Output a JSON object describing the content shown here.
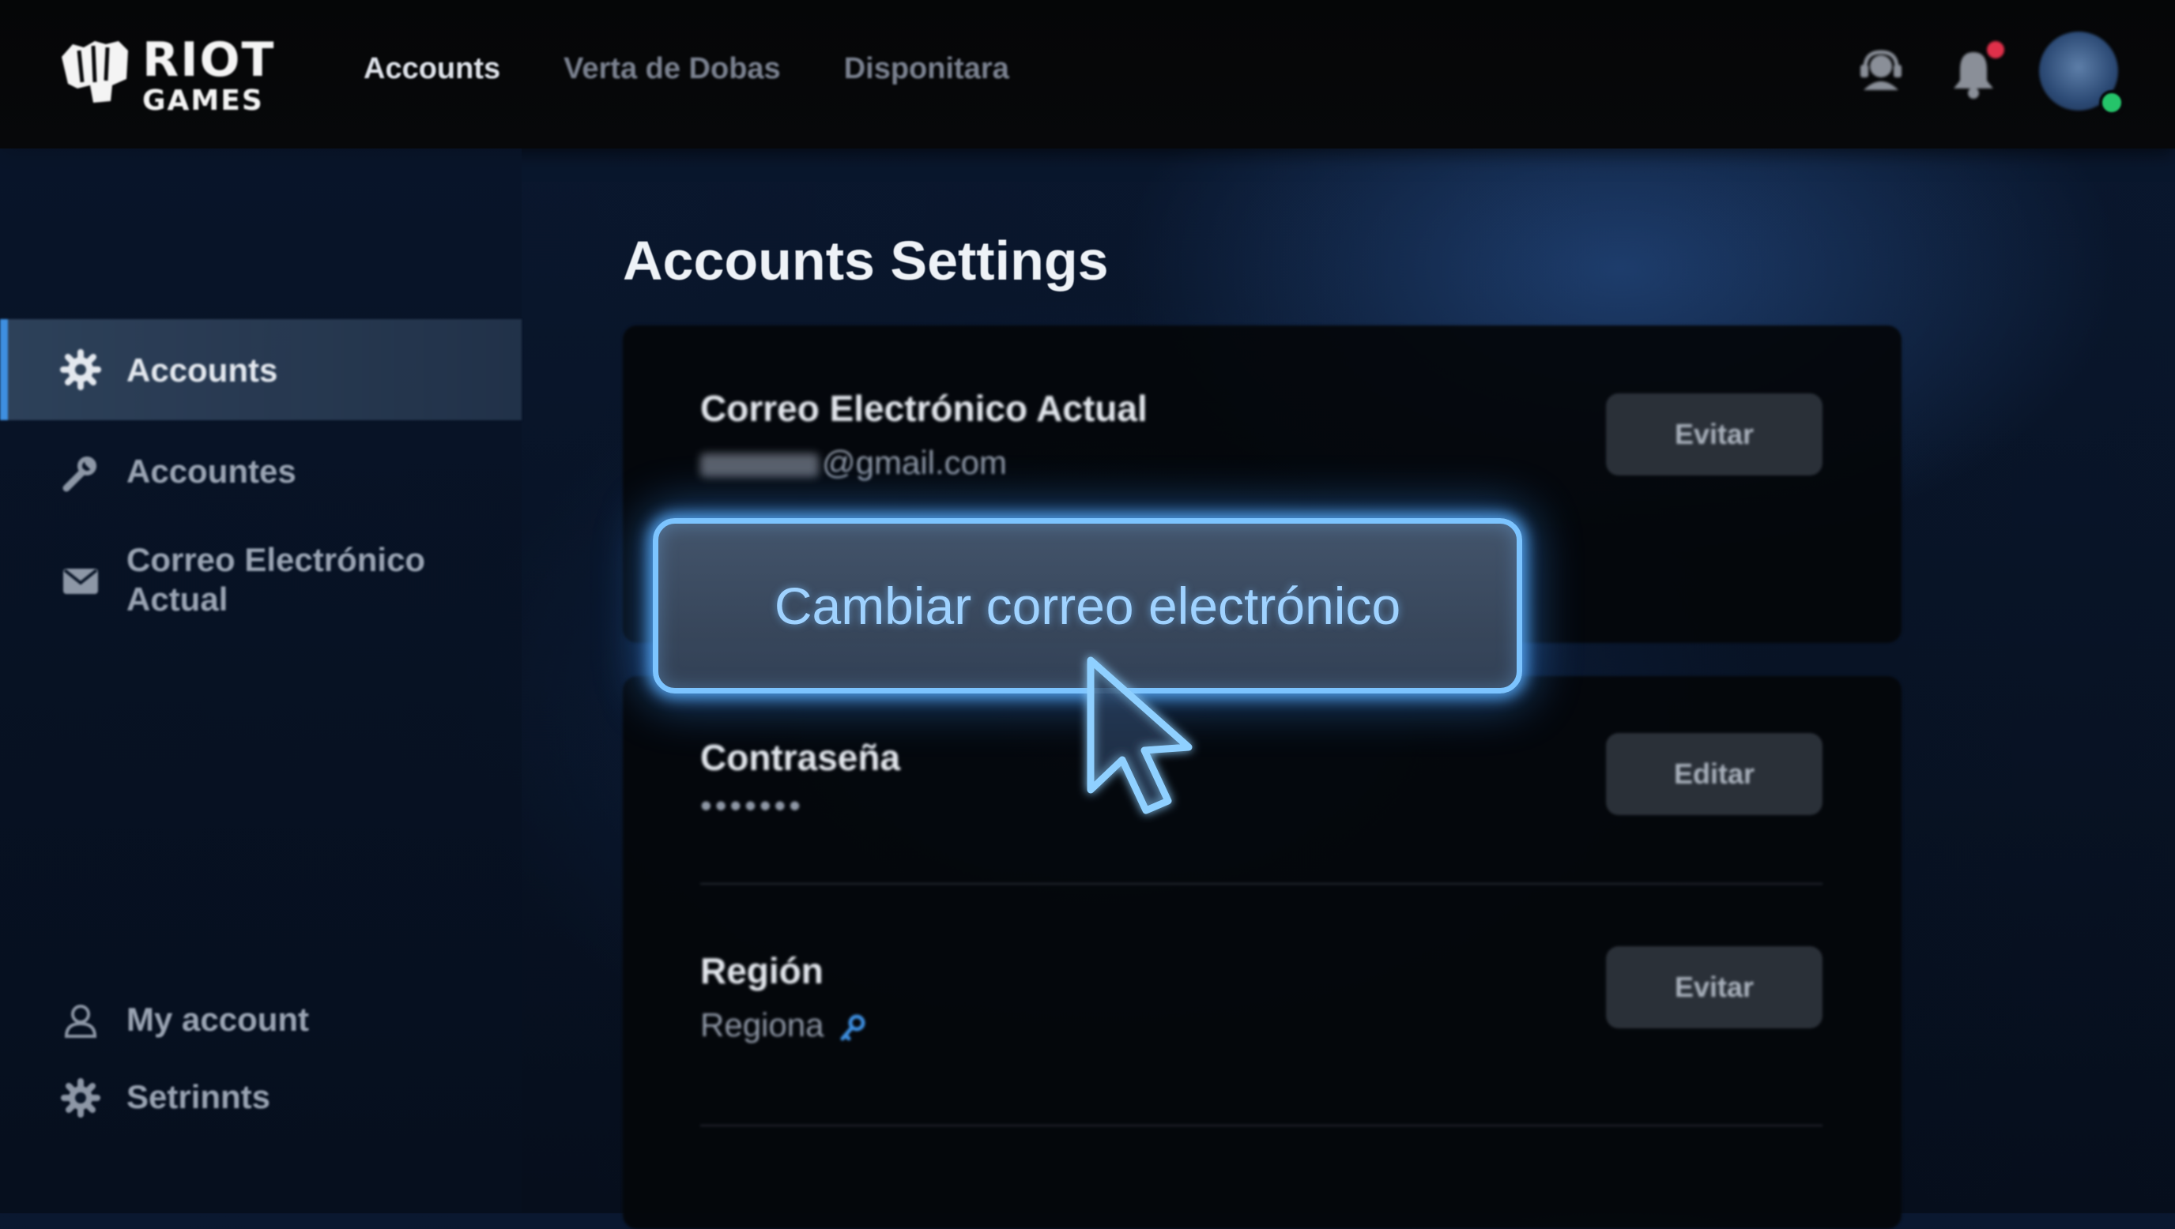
{
  "brand": {
    "name_line1": "RIOT",
    "name_line2": "GAMES"
  },
  "topnav": {
    "items": [
      {
        "label": "Accounts",
        "active": true
      },
      {
        "label": "Verta de Dobas",
        "active": false
      },
      {
        "label": "Disponitara",
        "active": false
      }
    ],
    "icons": [
      "support-icon",
      "bell-icon",
      "avatar"
    ]
  },
  "sidebar": {
    "items": [
      {
        "label": "Accounts",
        "icon": "gear-icon",
        "active": true
      },
      {
        "label": "Accountes",
        "icon": "wrench-icon",
        "active": false
      },
      {
        "label": "Correo Electrónico Actual",
        "icon": "mail-icon",
        "active": false
      }
    ],
    "bottom": [
      {
        "label": "My account",
        "icon": "user-icon"
      },
      {
        "label": "Setrinnts",
        "icon": "gear-icon"
      }
    ]
  },
  "main": {
    "title": "Accounts Settings",
    "email_row": {
      "title": "Correo Electrónico Actual",
      "value": "@gmail.com",
      "button": "Evitar"
    },
    "cta": {
      "label": "Cambiar correo electrónico"
    },
    "password_row": {
      "title": "Contraseña",
      "value": "•••••••",
      "button": "Editar"
    },
    "region_row": {
      "title": "Región",
      "value": "Regiona",
      "button": "Evitar"
    }
  },
  "colors": {
    "accent": "#3e8fe0",
    "cta_glow": "#7cc4ff",
    "cta_text": "#9fd2ff",
    "notification": "#e0304a",
    "online": "#25c46a"
  }
}
